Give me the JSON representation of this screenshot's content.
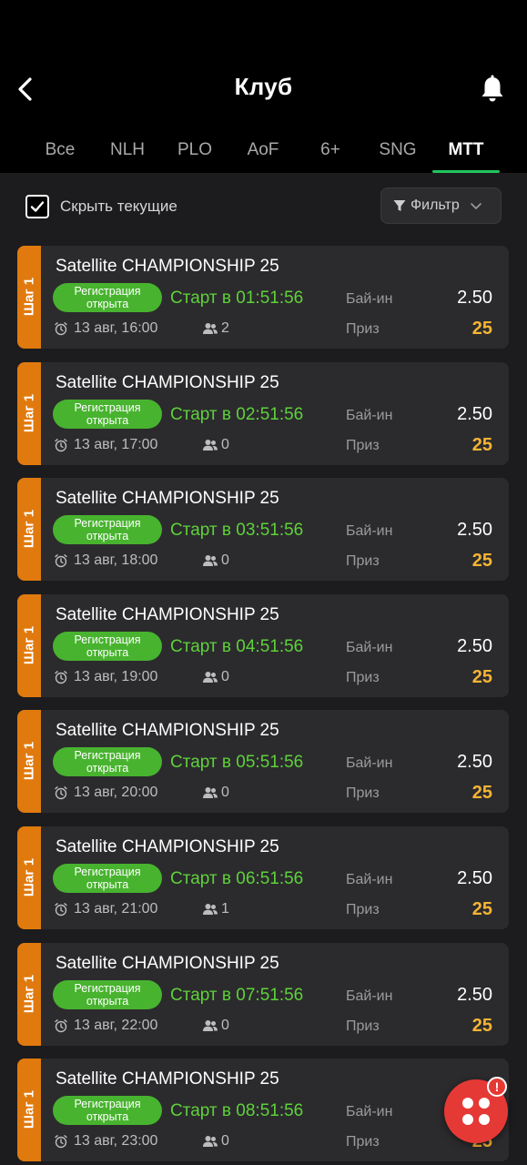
{
  "header": {
    "title": "Клуб"
  },
  "tabs": [
    "Все",
    "NLH",
    "PLO",
    "AoF",
    "6+",
    "SNG",
    "MTT"
  ],
  "active_tab": "MTT",
  "hide_current": {
    "label": "Скрыть текущие",
    "checked": true
  },
  "filter": {
    "label": "Фильтр"
  },
  "labels": {
    "step": "Шаг 1",
    "registration": "Регистрация открыта",
    "buyin": "Бай-ин",
    "prize": "Приз"
  },
  "tournaments": [
    {
      "name": "Satellite CHAMPIONSHIP 25",
      "start": "Старт в 01:51:56",
      "date": "13 авг, 16:00",
      "players": "2",
      "buyin": "2.50",
      "prize": "25"
    },
    {
      "name": "Satellite CHAMPIONSHIP 25",
      "start": "Старт в 02:51:56",
      "date": "13 авг, 17:00",
      "players": "0",
      "buyin": "2.50",
      "prize": "25"
    },
    {
      "name": "Satellite CHAMPIONSHIP 25",
      "start": "Старт в 03:51:56",
      "date": "13 авг, 18:00",
      "players": "0",
      "buyin": "2.50",
      "prize": "25"
    },
    {
      "name": "Satellite CHAMPIONSHIP 25",
      "start": "Старт в 04:51:56",
      "date": "13 авг, 19:00",
      "players": "0",
      "buyin": "2.50",
      "prize": "25"
    },
    {
      "name": "Satellite CHAMPIONSHIP 25",
      "start": "Старт в 05:51:56",
      "date": "13 авг, 20:00",
      "players": "0",
      "buyin": "2.50",
      "prize": "25"
    },
    {
      "name": "Satellite CHAMPIONSHIP 25",
      "start": "Старт в 06:51:56",
      "date": "13 авг, 21:00",
      "players": "1",
      "buyin": "2.50",
      "prize": "25"
    },
    {
      "name": "Satellite CHAMPIONSHIP 25",
      "start": "Старт в 07:51:56",
      "date": "13 авг, 22:00",
      "players": "0",
      "buyin": "2.50",
      "prize": "25"
    },
    {
      "name": "Satellite CHAMPIONSHIP 25",
      "start": "Старт в 08:51:56",
      "date": "13 авг, 23:00",
      "players": "0",
      "buyin": "2.50",
      "prize": "25"
    }
  ],
  "fab": {
    "badge": "!"
  },
  "colors": {
    "accent_green": "#22c55e",
    "start_green": "#5fd13a",
    "step_orange": "#e07a0e",
    "prize_gold": "#f5b433",
    "fab_red": "#e53935"
  }
}
